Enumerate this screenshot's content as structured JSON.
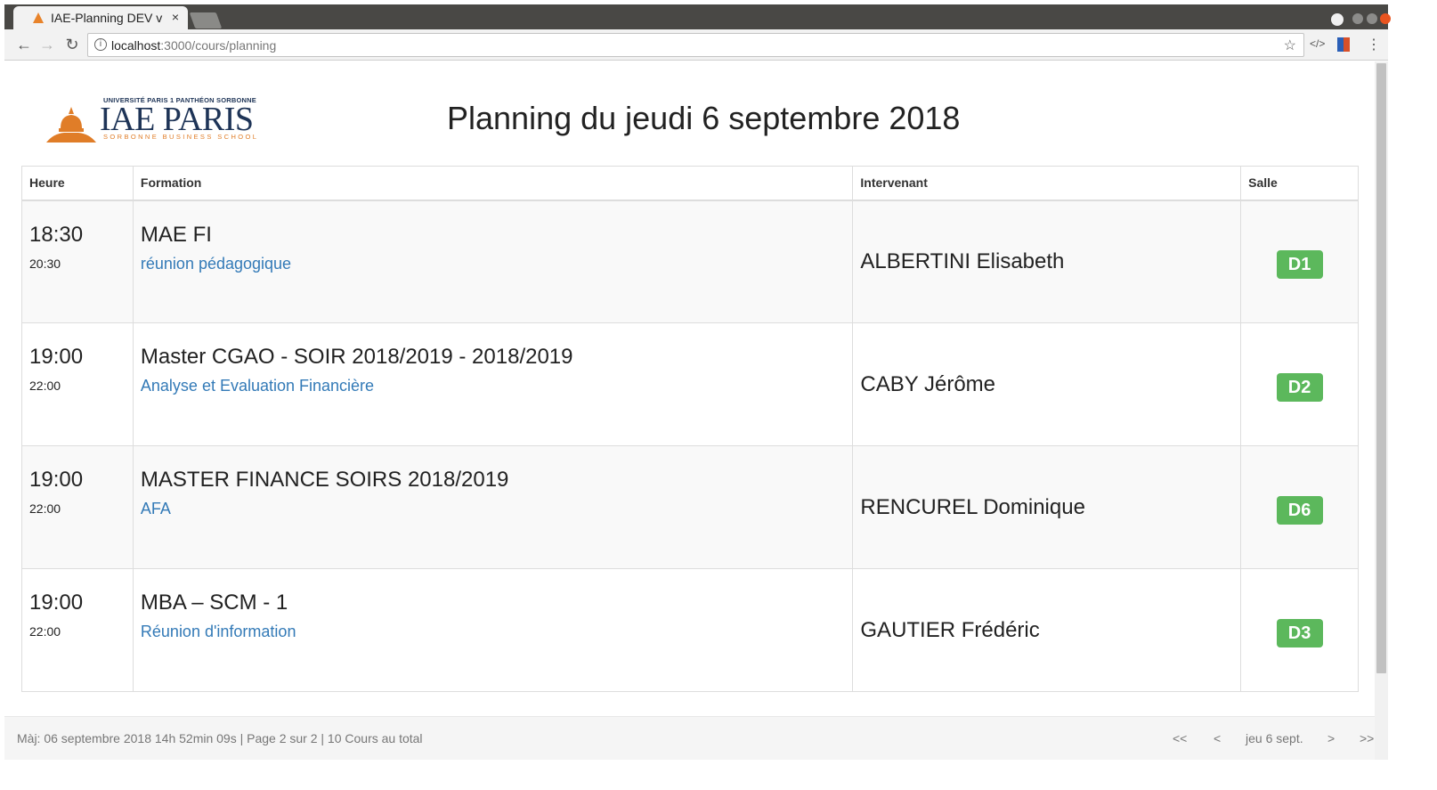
{
  "browser": {
    "tab_title": "IAE-Planning DEV v",
    "tab_close": "×",
    "url_host": "localhost",
    "url_path": ":3000/cours/planning",
    "info_glyph": "i",
    "star_glyph": "☆",
    "back_glyph": "←",
    "forward_glyph": "→",
    "reload_glyph": "↻",
    "devtools_glyph": "</>",
    "menu_glyph": "⋮"
  },
  "logo": {
    "university": "UNIVERSITÉ PARIS 1 PANTHÉON SORBONNE",
    "brand": "IAE PARIS",
    "subtitle": "SORBONNE BUSINESS SCHOOL"
  },
  "page": {
    "title": "Planning du jeudi 6 septembre 2018"
  },
  "table": {
    "headers": {
      "heure": "Heure",
      "formation": "Formation",
      "intervenant": "Intervenant",
      "salle": "Salle"
    },
    "rows": [
      {
        "start": "18:30",
        "end": "20:30",
        "formation": "MAE FI",
        "cours": "réunion pédagogique",
        "intervenant": "ALBERTINI Elisabeth",
        "salle": "D1"
      },
      {
        "start": "19:00",
        "end": "22:00",
        "formation": "Master CGAO - SOIR 2018/2019 - 2018/2019",
        "cours": "Analyse et Evaluation Financière",
        "intervenant": "CABY Jérôme",
        "salle": "D2"
      },
      {
        "start": "19:00",
        "end": "22:00",
        "formation": "MASTER FINANCE SOIRS 2018/2019",
        "cours": "AFA",
        "intervenant": "RENCUREL Dominique",
        "salle": "D6"
      },
      {
        "start": "19:00",
        "end": "22:00",
        "formation": "MBA – SCM - 1",
        "cours": "Réunion d'information",
        "intervenant": "GAUTIER Frédéric",
        "salle": "D3"
      }
    ]
  },
  "footer": {
    "status": "Màj: 06 septembre 2018 14h 52min 09s | Page 2 sur 2 | 10 Cours au total",
    "first": "<<",
    "prev": "<",
    "current_date": "jeu 6 sept.",
    "next": ">",
    "last": ">>"
  },
  "colors": {
    "badge": "#5cb85c",
    "link": "#337ab7",
    "logo_navy": "#1e3457",
    "logo_orange": "#e07d28"
  }
}
